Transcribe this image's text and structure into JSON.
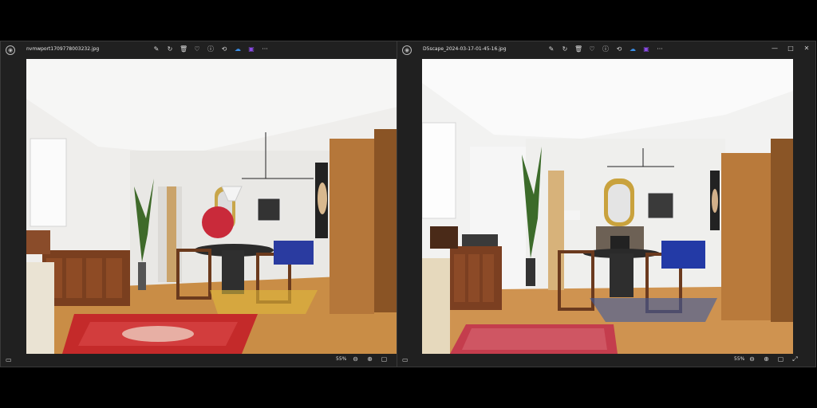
{
  "windows": [
    {
      "filename": "nvmwport1709778003232.jpg",
      "zoom": "55%",
      "toolbar_icons": [
        "edit-icon",
        "rotate-icon",
        "delete-icon",
        "favorite-icon",
        "info-icon",
        "enhance-icon",
        "onedrive-icon",
        "clipchamp-icon",
        "more-icon"
      ],
      "toolbar_glyphs": [
        "✎",
        "↻",
        "🗑",
        "♡",
        "ⓘ",
        "⟲",
        "☁",
        "▣",
        "···"
      ]
    },
    {
      "filename": "D5scape_2024-03-17-01-45-16.jpg",
      "zoom": "55%",
      "toolbar_icons": [
        "edit-icon",
        "rotate-icon",
        "delete-icon",
        "favorite-icon",
        "info-icon",
        "enhance-icon",
        "onedrive-icon",
        "clipchamp-icon",
        "more-icon"
      ],
      "toolbar_glyphs": [
        "✎",
        "↻",
        "🗑",
        "♡",
        "ⓘ",
        "⟲",
        "☁",
        "▣",
        "···"
      ]
    }
  ],
  "window_controls": {
    "minimize": "—",
    "maximize": "□",
    "close": "✕"
  },
  "status_glyphs": {
    "film": "▭",
    "zoom_out": "⊖",
    "zoom_in": "⊕",
    "fit": "▢",
    "full": "⤢"
  },
  "colors": {
    "window_bg": "#202020",
    "floor": "#c98d46",
    "wall": "#ededeb",
    "rug_red": "#c42a2a",
    "wood_panel": "#b5773a"
  }
}
